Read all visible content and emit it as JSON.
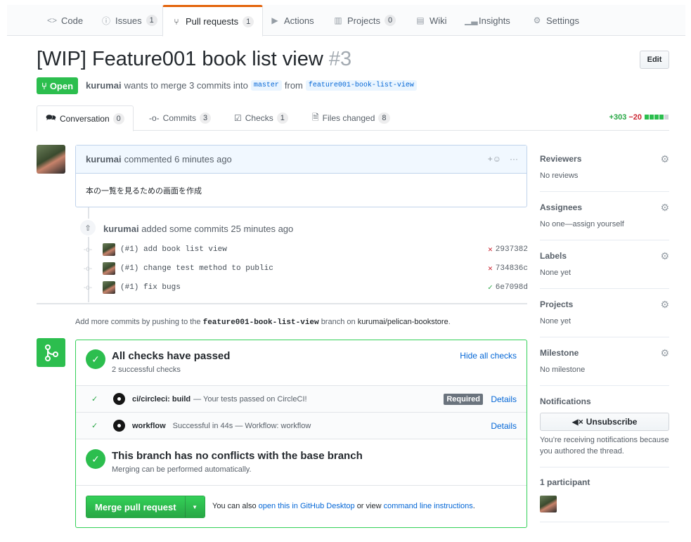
{
  "repo_nav": {
    "tabs": [
      {
        "label": "Code",
        "icon": "code-icon",
        "count": null
      },
      {
        "label": "Issues",
        "icon": "issue-icon",
        "count": "1"
      },
      {
        "label": "Pull requests",
        "icon": "pull-request-icon",
        "count": "1",
        "selected": true
      },
      {
        "label": "Actions",
        "icon": "play-icon",
        "count": null
      },
      {
        "label": "Projects",
        "icon": "project-icon",
        "count": "0"
      },
      {
        "label": "Wiki",
        "icon": "book-icon",
        "count": null
      },
      {
        "label": "Insights",
        "icon": "graph-icon",
        "count": null
      },
      {
        "label": "Settings",
        "icon": "gear-icon",
        "count": null
      }
    ]
  },
  "pr": {
    "title": "[WIP] Feature001 book list view",
    "number": "#3",
    "edit_label": "Edit",
    "state_label": "Open",
    "author": "kurumai",
    "merge_text": "wants to merge 3 commits into",
    "base_branch": "master",
    "from_text": "from",
    "head_branch": "feature001-book-list-view"
  },
  "pr_tabs": [
    {
      "label": "Conversation",
      "count": "0",
      "icon": "comment-icon",
      "selected": true
    },
    {
      "label": "Commits",
      "count": "3",
      "icon": "commit-icon"
    },
    {
      "label": "Checks",
      "count": "1",
      "icon": "checklist-icon"
    },
    {
      "label": "Files changed",
      "count": "8",
      "icon": "file-diff-icon"
    }
  ],
  "diffstat": {
    "additions": "+303",
    "deletions": "−20"
  },
  "comment": {
    "author": "kurumai",
    "action": "commented 6 minutes ago",
    "body": "本の一覧を見るための画面を作成"
  },
  "commits_event": {
    "author": "kurumai",
    "text": "added some commits 25 minutes ago",
    "commits": [
      {
        "message": "(#1) add book list view",
        "sha": "2937382",
        "status": "fail"
      },
      {
        "message": "(#1) change test method to public",
        "sha": "734836c",
        "status": "fail"
      },
      {
        "message": "(#1) fix bugs",
        "sha": "6e7098d",
        "status": "success"
      }
    ]
  },
  "push_hint": {
    "prefix": "Add more commits by pushing to the",
    "branch": "feature001-book-list-view",
    "middle": "branch on",
    "repo": "kurumai/pelican-bookstore",
    "suffix": "."
  },
  "merge_box": {
    "checks_title": "All checks have passed",
    "checks_sub": "2 successful checks",
    "hide_checks": "Hide all checks",
    "checks": [
      {
        "name": "ci/circleci: build",
        "desc": "— Your tests passed on CircleCI!",
        "required": "Required",
        "details": "Details"
      },
      {
        "name": "workflow",
        "desc": "Successful in 44s — Workflow: workflow",
        "required": null,
        "details": "Details"
      }
    ],
    "conflict_title": "This branch has no conflicts with the base branch",
    "conflict_sub": "Merging can be performed automatically.",
    "merge_button": "Merge pull request",
    "note_prefix": "You can also",
    "note_link1": "open this in GitHub Desktop",
    "note_middle": "or view",
    "note_link2": "command line instructions",
    "note_suffix": "."
  },
  "sidebar": {
    "reviewers": {
      "title": "Reviewers",
      "value": "No reviews"
    },
    "assignees": {
      "title": "Assignees",
      "value": "No one—assign yourself"
    },
    "labels": {
      "title": "Labels",
      "value": "None yet"
    },
    "projects": {
      "title": "Projects",
      "value": "None yet"
    },
    "milestone": {
      "title": "Milestone",
      "value": "No milestone"
    },
    "notifications": {
      "title": "Notifications",
      "button": "Unsubscribe",
      "note": "You’re receiving notifications because you authored the thread."
    },
    "participants": {
      "title": "1 participant"
    }
  },
  "colors": {
    "accent_green": "#2cbe4e",
    "link_blue": "#0366d6",
    "fail_red": "#cb2431",
    "tab_orange": "#e36209"
  }
}
